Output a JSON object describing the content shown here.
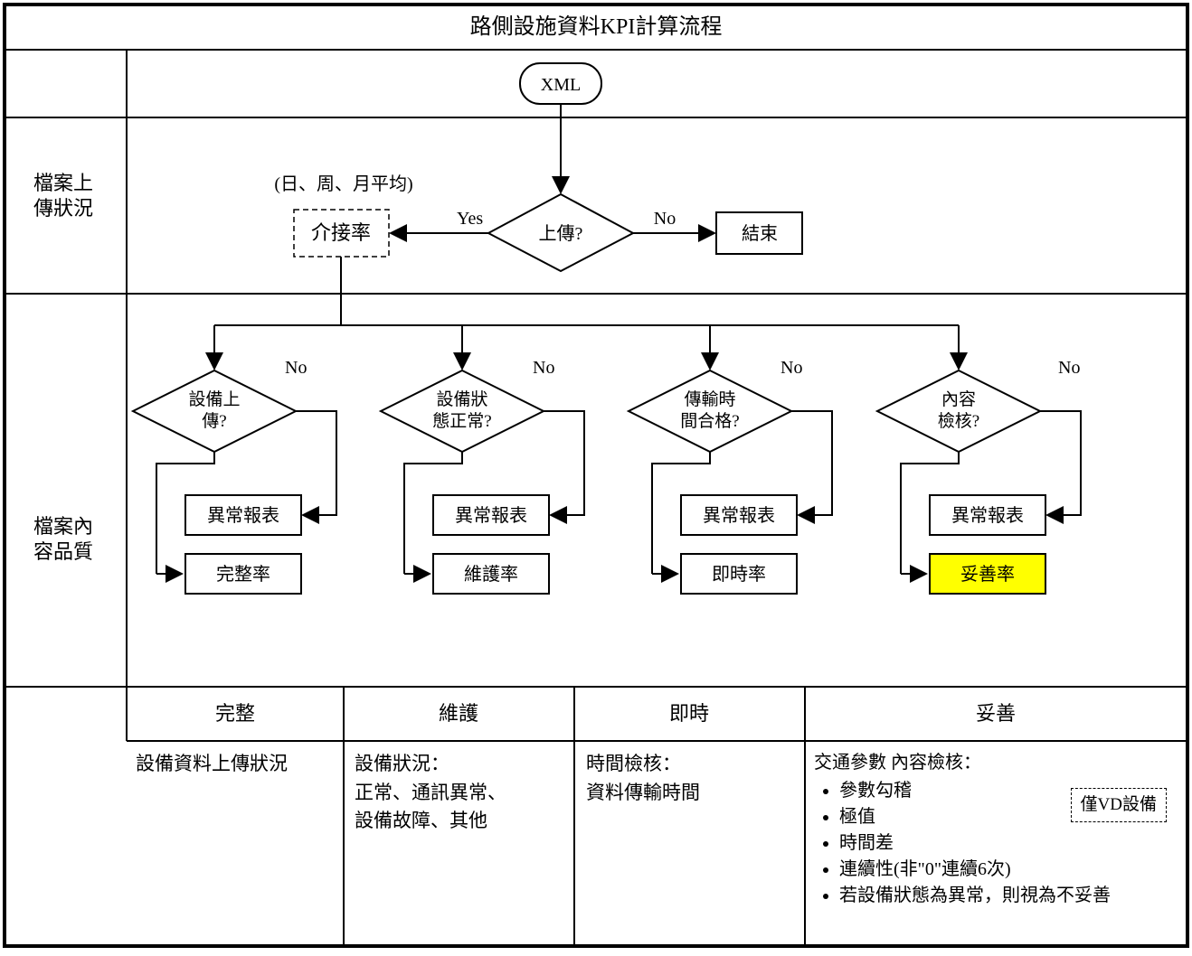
{
  "title": "路側設施資料KPI計算流程",
  "rowLabels": {
    "upload": "檔案上傳狀況",
    "content": "檔案內容品質"
  },
  "top": {
    "start": "XML",
    "decision": "上傳?",
    "end": "結束",
    "yes": "Yes",
    "no": "No",
    "note": "(日、周、月平均)",
    "metric": "介接率"
  },
  "labels": {
    "no": "No"
  },
  "branches": [
    {
      "decisionL1": "設備上",
      "decisionL2": "傳?",
      "report": "異常報表",
      "metric": "完整率"
    },
    {
      "decisionL1": "設備狀",
      "decisionL2": "態正常?",
      "report": "異常報表",
      "metric": "維護率"
    },
    {
      "decisionL1": "傳輸時",
      "decisionL2": "間合格?",
      "report": "異常報表",
      "metric": "即時率"
    },
    {
      "decisionL1": "內容",
      "decisionL2": "檢核?",
      "report": "異常報表",
      "metric": "妥善率"
    }
  ],
  "summary": {
    "headers": [
      "完整",
      "維護",
      "即時",
      "妥善"
    ],
    "cells": {
      "c1": "設備資料上傳狀況",
      "c2": "設備狀況：\n正常、通訊異常、\n設備故障、其他",
      "c3": "時間檢核：\n資料傳輸時間",
      "c4title": "交通參數 內容檢核：",
      "c4items": [
        "參數勾稽",
        "極值",
        "時間差",
        "連續性(非\"0\"連續6次)",
        "若設備狀態為異常，則視為不妥善"
      ],
      "c4note": "僅VD設備"
    }
  }
}
